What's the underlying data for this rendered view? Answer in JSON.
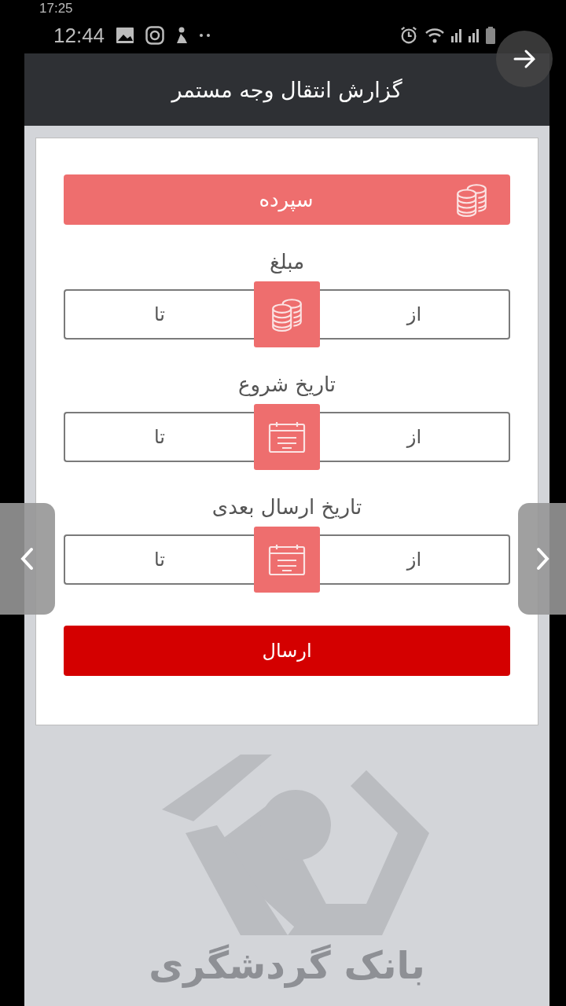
{
  "status_bars": [
    {
      "time": "17:25"
    },
    {
      "time": "12:44"
    }
  ],
  "header": {
    "title": "گزارش انتقال وجه مستمر"
  },
  "account_select": {
    "value": "سپرده"
  },
  "ranges": [
    {
      "kind": "amount",
      "label": "مبلغ",
      "from_placeholder": "از",
      "to_placeholder": "تا"
    },
    {
      "kind": "date",
      "label": "تاریخ شروع",
      "from_placeholder": "از",
      "to_placeholder": "تا"
    },
    {
      "kind": "date",
      "label": "تاریخ ارسال بعدی",
      "from_placeholder": "از",
      "to_placeholder": "تا"
    }
  ],
  "submit": {
    "label": "ارسال"
  },
  "logo": {
    "text": "بانک گردشگری"
  }
}
